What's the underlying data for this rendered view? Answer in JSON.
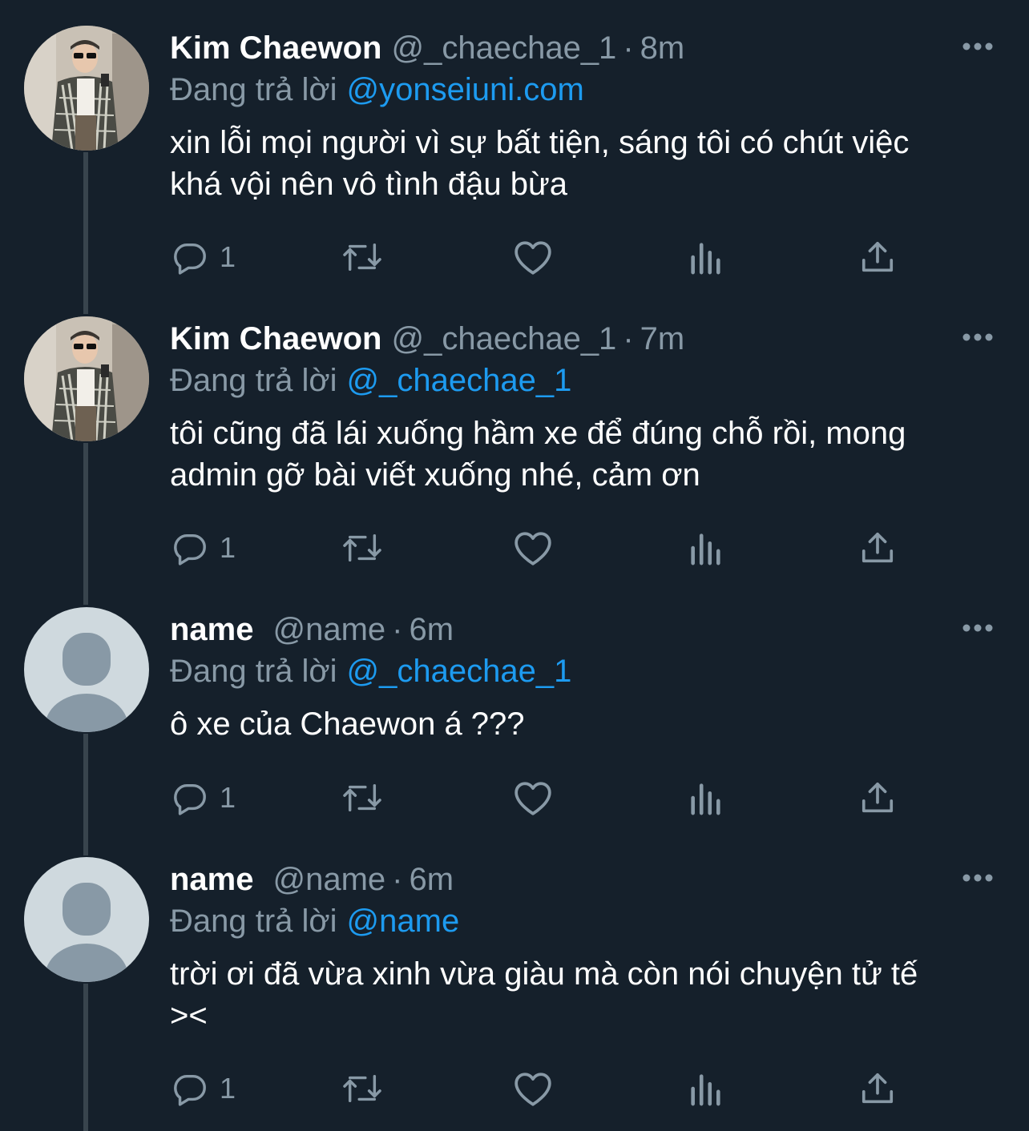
{
  "colors": {
    "background": "#15202b",
    "secondary_text": "#8899a6",
    "link": "#1d9bf0",
    "thread_line": "#38444d"
  },
  "tweets": [
    {
      "avatar": "photo-avatar",
      "display_name": "Kim Chaewon",
      "handle": "@_chaechae_1",
      "separator": "·",
      "time": "8m",
      "reply_prefix": "Đang trả lời",
      "reply_target": "@yonseiuni.com",
      "text_lines": [
        "xin lỗi mọi người vì sự bất tiện, sáng tôi có chút việc",
        "khá vội nên vô tình đậu bừa"
      ],
      "reply_count": "1"
    },
    {
      "avatar": "photo-avatar",
      "display_name": "Kim Chaewon",
      "handle": "@_chaechae_1",
      "separator": "·",
      "time": "7m",
      "reply_prefix": "Đang trả lời",
      "reply_target": "@_chaechae_1",
      "text_lines": [
        "tôi cũng đã lái xuống hầm xe để đúng chỗ rồi, mong",
        "admin gỡ bài viết xuống nhé, cảm ơn"
      ],
      "reply_count": "1"
    },
    {
      "avatar": "default-avatar",
      "display_name": "name",
      "handle": "@name",
      "separator": "·",
      "time": "6m",
      "reply_prefix": "Đang trả lời",
      "reply_target": "@_chaechae_1",
      "text_lines": [
        "ô xe của Chaewon á ???"
      ],
      "reply_count": "1"
    },
    {
      "avatar": "default-avatar",
      "display_name": "name",
      "handle": "@name",
      "separator": "·",
      "time": "6m",
      "reply_prefix": "Đang trả lời",
      "reply_target": "@name",
      "text_lines": [
        "trời ơi đã vừa xinh vừa giàu mà còn nói chuyện tử tế",
        "><"
      ],
      "reply_count": "1"
    }
  ]
}
